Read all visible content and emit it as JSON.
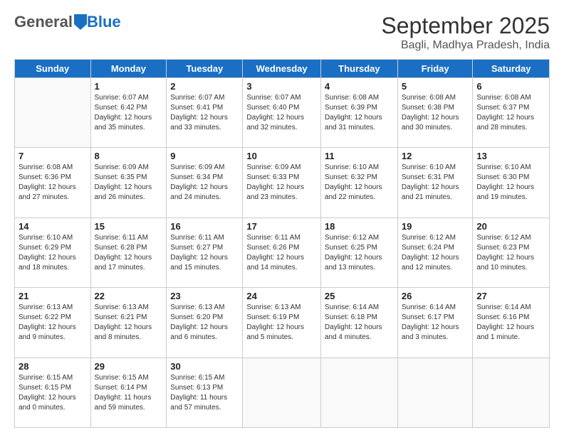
{
  "logo": {
    "general": "General",
    "blue": "Blue"
  },
  "header": {
    "title": "September 2025",
    "subtitle": "Bagli, Madhya Pradesh, India"
  },
  "weekdays": [
    "Sunday",
    "Monday",
    "Tuesday",
    "Wednesday",
    "Thursday",
    "Friday",
    "Saturday"
  ],
  "weeks": [
    [
      {
        "day": "",
        "info": ""
      },
      {
        "day": "1",
        "info": "Sunrise: 6:07 AM\nSunset: 6:42 PM\nDaylight: 12 hours\nand 35 minutes."
      },
      {
        "day": "2",
        "info": "Sunrise: 6:07 AM\nSunset: 6:41 PM\nDaylight: 12 hours\nand 33 minutes."
      },
      {
        "day": "3",
        "info": "Sunrise: 6:07 AM\nSunset: 6:40 PM\nDaylight: 12 hours\nand 32 minutes."
      },
      {
        "day": "4",
        "info": "Sunrise: 6:08 AM\nSunset: 6:39 PM\nDaylight: 12 hours\nand 31 minutes."
      },
      {
        "day": "5",
        "info": "Sunrise: 6:08 AM\nSunset: 6:38 PM\nDaylight: 12 hours\nand 30 minutes."
      },
      {
        "day": "6",
        "info": "Sunrise: 6:08 AM\nSunset: 6:37 PM\nDaylight: 12 hours\nand 28 minutes."
      }
    ],
    [
      {
        "day": "7",
        "info": "Sunrise: 6:08 AM\nSunset: 6:36 PM\nDaylight: 12 hours\nand 27 minutes."
      },
      {
        "day": "8",
        "info": "Sunrise: 6:09 AM\nSunset: 6:35 PM\nDaylight: 12 hours\nand 26 minutes."
      },
      {
        "day": "9",
        "info": "Sunrise: 6:09 AM\nSunset: 6:34 PM\nDaylight: 12 hours\nand 24 minutes."
      },
      {
        "day": "10",
        "info": "Sunrise: 6:09 AM\nSunset: 6:33 PM\nDaylight: 12 hours\nand 23 minutes."
      },
      {
        "day": "11",
        "info": "Sunrise: 6:10 AM\nSunset: 6:32 PM\nDaylight: 12 hours\nand 22 minutes."
      },
      {
        "day": "12",
        "info": "Sunrise: 6:10 AM\nSunset: 6:31 PM\nDaylight: 12 hours\nand 21 minutes."
      },
      {
        "day": "13",
        "info": "Sunrise: 6:10 AM\nSunset: 6:30 PM\nDaylight: 12 hours\nand 19 minutes."
      }
    ],
    [
      {
        "day": "14",
        "info": "Sunrise: 6:10 AM\nSunset: 6:29 PM\nDaylight: 12 hours\nand 18 minutes."
      },
      {
        "day": "15",
        "info": "Sunrise: 6:11 AM\nSunset: 6:28 PM\nDaylight: 12 hours\nand 17 minutes."
      },
      {
        "day": "16",
        "info": "Sunrise: 6:11 AM\nSunset: 6:27 PM\nDaylight: 12 hours\nand 15 minutes."
      },
      {
        "day": "17",
        "info": "Sunrise: 6:11 AM\nSunset: 6:26 PM\nDaylight: 12 hours\nand 14 minutes."
      },
      {
        "day": "18",
        "info": "Sunrise: 6:12 AM\nSunset: 6:25 PM\nDaylight: 12 hours\nand 13 minutes."
      },
      {
        "day": "19",
        "info": "Sunrise: 6:12 AM\nSunset: 6:24 PM\nDaylight: 12 hours\nand 12 minutes."
      },
      {
        "day": "20",
        "info": "Sunrise: 6:12 AM\nSunset: 6:23 PM\nDaylight: 12 hours\nand 10 minutes."
      }
    ],
    [
      {
        "day": "21",
        "info": "Sunrise: 6:13 AM\nSunset: 6:22 PM\nDaylight: 12 hours\nand 9 minutes."
      },
      {
        "day": "22",
        "info": "Sunrise: 6:13 AM\nSunset: 6:21 PM\nDaylight: 12 hours\nand 8 minutes."
      },
      {
        "day": "23",
        "info": "Sunrise: 6:13 AM\nSunset: 6:20 PM\nDaylight: 12 hours\nand 6 minutes."
      },
      {
        "day": "24",
        "info": "Sunrise: 6:13 AM\nSunset: 6:19 PM\nDaylight: 12 hours\nand 5 minutes."
      },
      {
        "day": "25",
        "info": "Sunrise: 6:14 AM\nSunset: 6:18 PM\nDaylight: 12 hours\nand 4 minutes."
      },
      {
        "day": "26",
        "info": "Sunrise: 6:14 AM\nSunset: 6:17 PM\nDaylight: 12 hours\nand 3 minutes."
      },
      {
        "day": "27",
        "info": "Sunrise: 6:14 AM\nSunset: 6:16 PM\nDaylight: 12 hours\nand 1 minute."
      }
    ],
    [
      {
        "day": "28",
        "info": "Sunrise: 6:15 AM\nSunset: 6:15 PM\nDaylight: 12 hours\nand 0 minutes."
      },
      {
        "day": "29",
        "info": "Sunrise: 6:15 AM\nSunset: 6:14 PM\nDaylight: 11 hours\nand 59 minutes."
      },
      {
        "day": "30",
        "info": "Sunrise: 6:15 AM\nSunset: 6:13 PM\nDaylight: 11 hours\nand 57 minutes."
      },
      {
        "day": "",
        "info": ""
      },
      {
        "day": "",
        "info": ""
      },
      {
        "day": "",
        "info": ""
      },
      {
        "day": "",
        "info": ""
      }
    ]
  ]
}
